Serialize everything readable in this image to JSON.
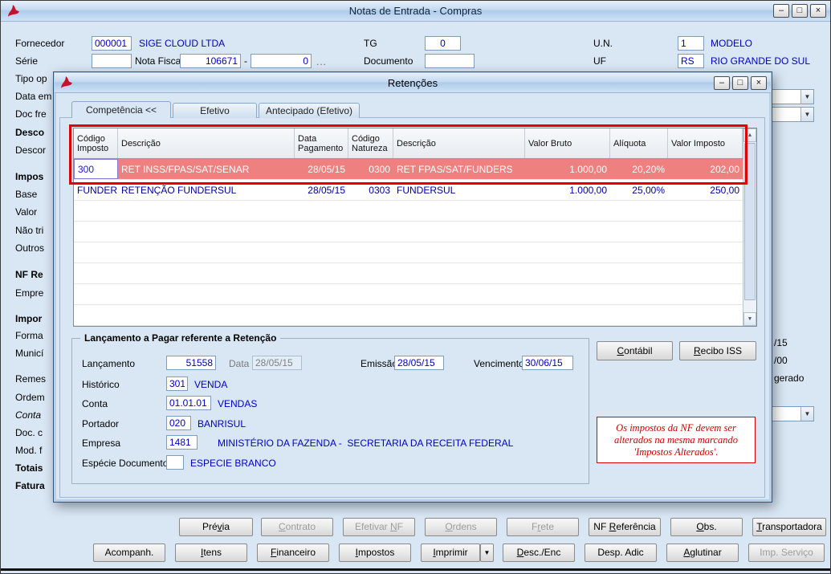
{
  "colors": {
    "value_text": "#0000bf",
    "grid_text": "#000098",
    "selected_row_bg": "#ee8080",
    "annotation_red": "#e30000",
    "warning_red": "#cc0000",
    "window_bg": "#d9e7f5",
    "titlebar_blue": "#bcd6f0"
  },
  "main_window": {
    "title": "Notas de Entrada - Compras",
    "row1": {
      "fornecedor_label": "Fornecedor",
      "fornecedor_code": "000001",
      "fornecedor_name": "SIGE CLOUD LTDA",
      "tg_label": "TG",
      "tg_value": "0",
      "un_label": "U.N.",
      "un_code": "1",
      "un_name": "MODELO"
    },
    "row2": {
      "serie_label": "Série",
      "serie_value": "",
      "nota_fiscal_label": "Nota Fiscal",
      "nota_fiscal_numero": "106671",
      "separator": "-",
      "nota_fiscal_sufixo": "0",
      "more_label": "...",
      "documento_label": "Documento",
      "documento_value": "",
      "uf_label": "UF",
      "uf_code": "RS",
      "uf_name": "RIO GRANDE DO SUL"
    },
    "left_labels": [
      "Tipo op",
      "Data em",
      "Doc fre",
      "Desco",
      "Descor",
      "Impos",
      "Base",
      "Valor",
      "Não tri",
      "Outros",
      "NF Re",
      "Empre",
      "Impor",
      "Forma",
      "Municí",
      "Remes",
      "Ordem",
      "Conta",
      "Doc. c",
      "Mod. f",
      "Totais",
      "Fatura"
    ],
    "right_fragments": [
      "/15",
      "/00",
      "gerado"
    ],
    "buttons_row1": [
      {
        "label": "Pré&via"
      },
      {
        "label": "&Contrato"
      },
      {
        "label": "Efetivar &NF"
      },
      {
        "label": "&Ordens"
      },
      {
        "label": "F&rete"
      },
      {
        "label": "NF &Referência"
      },
      {
        "label": "&Obs."
      },
      {
        "label": "&Transportadora"
      }
    ],
    "buttons_row2": [
      {
        "label": "Acompanh."
      },
      {
        "label": "&Itens"
      },
      {
        "label": "&Financeiro"
      },
      {
        "label": "&Impostos"
      },
      {
        "label": "&Imprimir"
      },
      {
        "label": "&Desc./Enc"
      },
      {
        "label": "Desp. Adic"
      },
      {
        "label": "&Aglutinar"
      },
      {
        "label": "Imp. Serviço"
      }
    ]
  },
  "dialog": {
    "title": "Retenções",
    "tabs": [
      "Competência <<",
      "Efetivo",
      "Antecipado (Efetivo)"
    ],
    "grid": {
      "columns": [
        "Código\nImposto",
        "Descrição",
        "Data\nPagamento",
        "Código\nNatureza",
        "Descrição",
        "Valor Bruto",
        "Alíquota",
        "Valor Imposto"
      ],
      "rows": [
        {
          "codigo_imposto": "300",
          "descricao": "RET INSS/FPAS/SAT/SENAR",
          "data_pagamento": "28/05/15",
          "codigo_natureza": "0300",
          "descricao_natureza": "RET FPAS/SAT/FUNDERS",
          "valor_bruto": "1.000,00",
          "aliquota": "20,20%",
          "valor_imposto": "202,00"
        },
        {
          "codigo_imposto": "FUNDER",
          "descricao": "RETENÇÃO FUNDERSUL",
          "data_pagamento": "28/05/15",
          "codigo_natureza": "0303",
          "descricao_natureza": "FUNDERSUL",
          "valor_bruto": "1.000,00",
          "aliquota": "25,00%",
          "valor_imposto": "250,00"
        }
      ]
    },
    "groupbox": {
      "title": "Lançamento a Pagar referente a Retenção",
      "lancamento": {
        "label": "Lançamento",
        "value": "51558"
      },
      "data": {
        "label": "Data",
        "value": "28/05/15"
      },
      "emissao": {
        "label": "Emissão",
        "value": "28/05/15"
      },
      "vencimento": {
        "label": "Vencimento",
        "value": "30/06/15"
      },
      "historico": {
        "label": "Histórico",
        "code": "301",
        "name": "VENDA"
      },
      "conta": {
        "label": "Conta",
        "code": "01.01.01",
        "name": "VENDAS"
      },
      "portador": {
        "label": "Portador",
        "code": "020",
        "name": "BANRISUL"
      },
      "empresa": {
        "label": "Empresa",
        "code": "1481",
        "name": "MINISTÉRIO DA FAZENDA -  SECRETARIA DA RECEITA FEDERAL"
      },
      "especie": {
        "label": "Espécie Documento",
        "value": "",
        "name": "ESPECIE BRANCO"
      }
    },
    "contabil_button": "&Contábil",
    "recibo_button": "&Recibo ISS",
    "warning": "Os impostos da NF devem ser alterados na mesma marcando 'Impostos Alterados'."
  }
}
